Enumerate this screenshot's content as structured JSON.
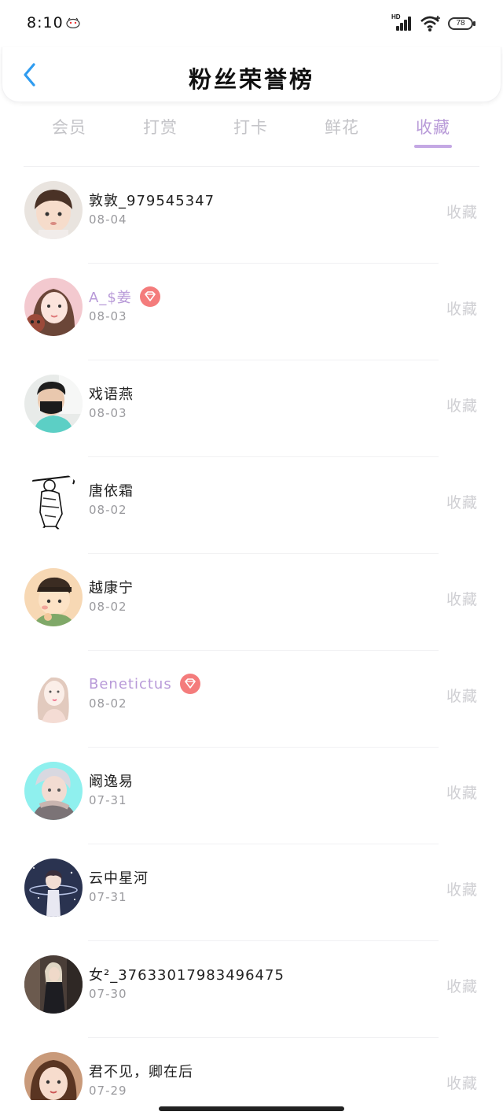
{
  "status_bar": {
    "time": "8:10",
    "network": "HD",
    "battery": "78"
  },
  "header": {
    "title": "粉丝荣誉榜"
  },
  "tabs": [
    {
      "label": "会员",
      "active": false
    },
    {
      "label": "打赏",
      "active": false
    },
    {
      "label": "打卡",
      "active": false
    },
    {
      "label": "鲜花",
      "active": false
    },
    {
      "label": "收藏",
      "active": true
    }
  ],
  "colors": {
    "accent": "#b89ad8",
    "vip_badge": "#f47c7c",
    "muted": "#cfcfd3"
  },
  "fans": [
    {
      "name": "敦敦_979545347",
      "date": "08-04",
      "action": "收藏",
      "vip": false,
      "avatar": "girl-bangs"
    },
    {
      "name": "A_$姜",
      "date": "08-03",
      "action": "收藏",
      "vip": true,
      "avatar": "girl-pink"
    },
    {
      "name": "戏语燕",
      "date": "08-03",
      "action": "收藏",
      "vip": false,
      "avatar": "man-mask"
    },
    {
      "name": "唐依霜",
      "date": "08-02",
      "action": "收藏",
      "vip": false,
      "avatar": "ink-warrior"
    },
    {
      "name": "越康宁",
      "date": "08-02",
      "action": "收藏",
      "vip": false,
      "avatar": "cartoon-kid"
    },
    {
      "name": "Benetictus",
      "date": "08-02",
      "action": "收藏",
      "vip": true,
      "avatar": "sketch-girl"
    },
    {
      "name": "阚逸易",
      "date": "07-31",
      "action": "收藏",
      "vip": false,
      "avatar": "anime-boy"
    },
    {
      "name": "云中星河",
      "date": "07-31",
      "action": "收藏",
      "vip": false,
      "avatar": "galaxy-boy"
    },
    {
      "name": "女²_37633017983496475",
      "date": "07-30",
      "action": "收藏",
      "vip": false,
      "avatar": "street-woman"
    },
    {
      "name": "君不见，卿在后",
      "date": "07-29",
      "action": "收藏",
      "vip": false,
      "avatar": "curly-girl"
    }
  ]
}
